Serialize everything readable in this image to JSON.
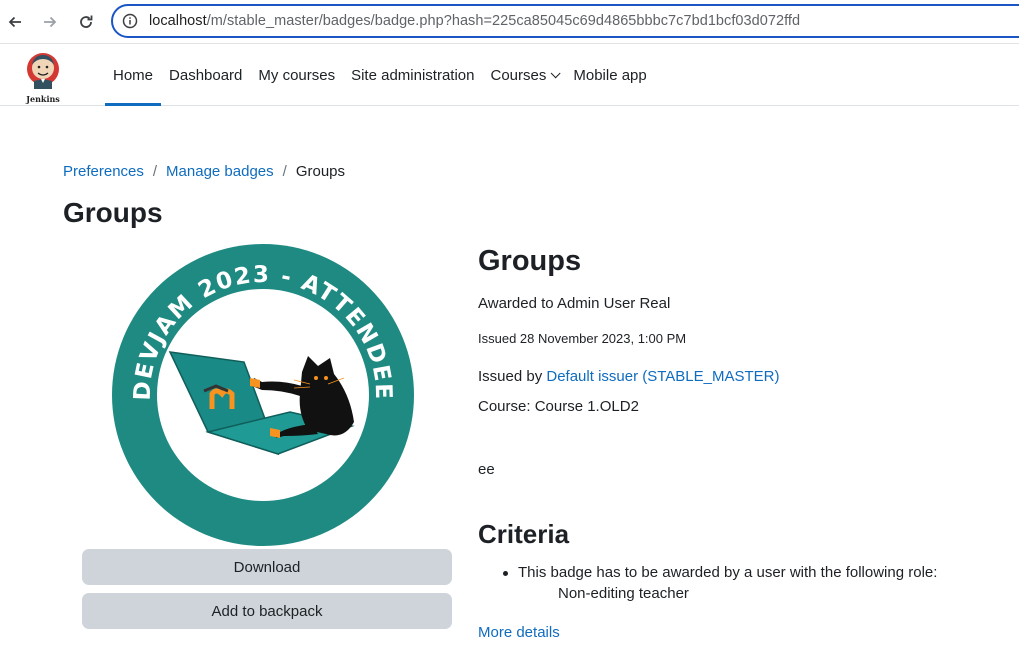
{
  "browser": {
    "url_host": "localhost",
    "url_path": "/m/stable_master/badges/badge.php?hash=225ca85045c69d4865bbbc7c7bd1bcf03d072ffd"
  },
  "navbar": {
    "logo_text": "Jenkins",
    "items": [
      {
        "label": "Home",
        "active": true
      },
      {
        "label": "Dashboard"
      },
      {
        "label": "My courses"
      },
      {
        "label": "Site administration"
      },
      {
        "label": "Courses",
        "dropdown": true
      },
      {
        "label": "Mobile app"
      }
    ]
  },
  "breadcrumb": [
    {
      "label": "Preferences"
    },
    {
      "label": "Manage badges"
    },
    {
      "label": "Groups"
    }
  ],
  "page_title": "Groups",
  "badge_image": {
    "text": "DEVJAM 2023 - ATTENDEE",
    "colors": {
      "ring": "#1e8a82",
      "laptop": "#1a8a86",
      "accent": "#f7931e"
    }
  },
  "buttons": {
    "download": "Download",
    "add_to_backpack": "Add to backpack"
  },
  "details": {
    "title": "Groups",
    "awarded_to": "Awarded to Admin User Real",
    "issued": "Issued 28 November 2023, 1:00 PM",
    "issued_by_prefix": "Issued by ",
    "issuer": "Default issuer (STABLE_MASTER)",
    "course": "Course: Course 1.OLD2",
    "description": "ee"
  },
  "criteria": {
    "heading": "Criteria",
    "item": "This badge has to be awarded by a user with the following role:",
    "role": "Non-editing teacher",
    "more_details": "More details"
  },
  "colors": {
    "link": "#0f6cbf",
    "button_bg": "#ced4da",
    "url_border": "#1a56c4"
  }
}
